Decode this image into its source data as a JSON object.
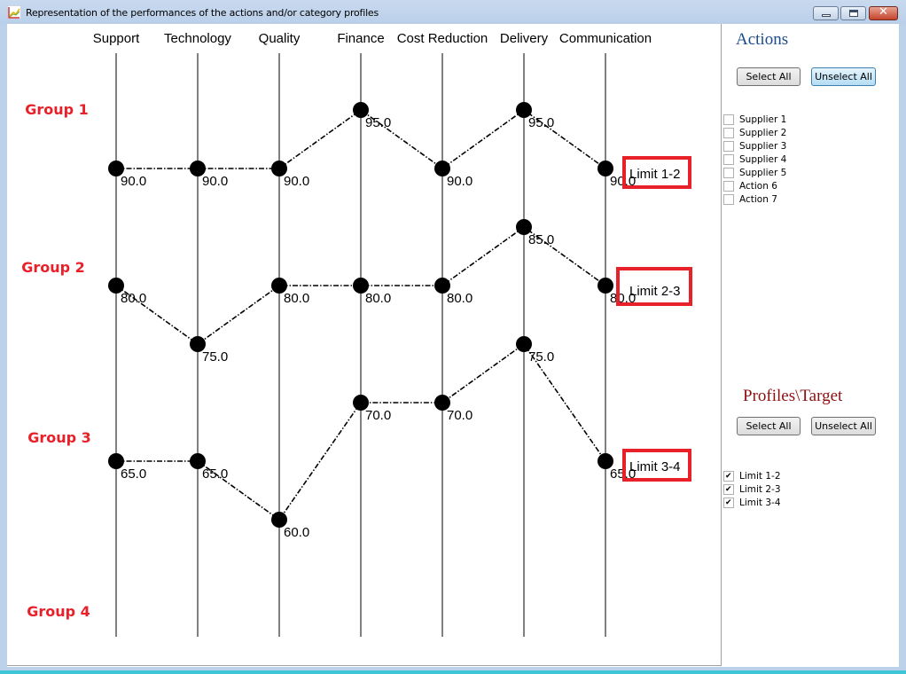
{
  "window": {
    "title": "Representation of the performances of the actions and/or category profiles",
    "icon": "chart-app-icon",
    "controls": {
      "minimize": "minimize-icon",
      "maximize": "maximize-icon",
      "close": "close-icon"
    }
  },
  "chart_data": {
    "type": "line",
    "subtype": "parallel-coordinates",
    "categories": [
      "Support",
      "Technology",
      "Quality",
      "Finance",
      "Cost Reduction",
      "Delivery",
      "Communication"
    ],
    "series": [
      {
        "name": "Limit 1-2",
        "values": [
          90.0,
          90.0,
          90.0,
          95.0,
          90.0,
          95.0,
          90.0
        ]
      },
      {
        "name": "Limit 2-3",
        "values": [
          80.0,
          75.0,
          80.0,
          80.0,
          80.0,
          85.0,
          80.0
        ]
      },
      {
        "name": "Limit 3-4",
        "values": [
          65.0,
          65.0,
          60.0,
          70.0,
          70.0,
          75.0,
          65.0
        ]
      }
    ],
    "data_labels": [
      [
        "90.0",
        "90.0",
        "90.0",
        "95.0",
        "90.0",
        "95.0",
        "90.0"
      ],
      [
        "80.0",
        "75.0",
        "80.0",
        "80.0",
        "80.0",
        "85.0",
        "80.0"
      ],
      [
        "65.0",
        "65.0",
        "60.0",
        "70.0",
        "70.0",
        "75.0",
        "65.0"
      ]
    ],
    "group_labels": [
      "Group 1",
      "Group 2",
      "Group 3",
      "Group 4"
    ],
    "annotation_color": "#e8202a",
    "group_label_color": "#e8202a",
    "line_style": "dash-dot",
    "marker": "filled-circle",
    "grid": false,
    "legend": "none"
  },
  "side_panel": {
    "actions": {
      "title": "Actions",
      "select_all": "Select All",
      "unselect_all": "Unselect All",
      "items": [
        {
          "label": "Supplier 1",
          "checked": false
        },
        {
          "label": "Supplier 2",
          "checked": false
        },
        {
          "label": "Supplier 3",
          "checked": false
        },
        {
          "label": "Supplier 4",
          "checked": false
        },
        {
          "label": "Supplier 5",
          "checked": false
        },
        {
          "label": "Action 6",
          "checked": false
        },
        {
          "label": "Action 7",
          "checked": false
        }
      ]
    },
    "profiles": {
      "title": "Profiles\\Target",
      "select_all": "Select All",
      "unselect_all": "Unselect All",
      "items": [
        {
          "label": "Limit 1-2",
          "checked": true
        },
        {
          "label": "Limit 2-3",
          "checked": true
        },
        {
          "label": "Limit 3-4",
          "checked": true
        }
      ]
    }
  }
}
